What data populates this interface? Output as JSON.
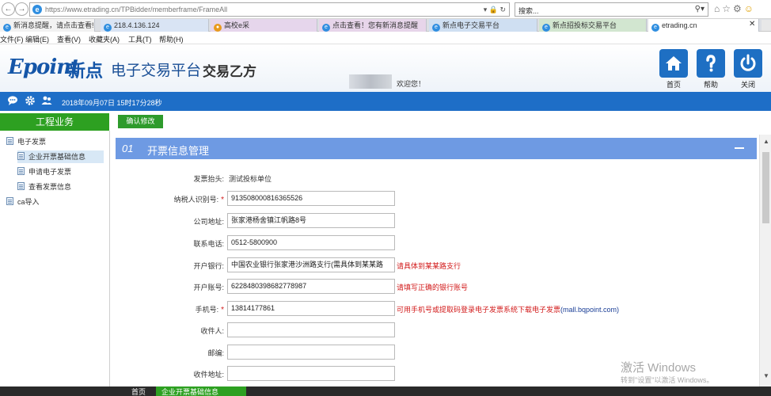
{
  "browser": {
    "url": "https://www.etrading.cn/TPBidder/memberframe/FrameAll",
    "search_placeholder": "搜索...",
    "tabs": [
      "新消息提醒，请点击查看!",
      "218.4.136.124",
      "高校e采",
      "点击查看！您有新消息提醒",
      "新点电子交易平台",
      "新点招投标交易平台",
      "etrading.cn"
    ],
    "menu": [
      "文件(F)",
      "编辑(E)",
      "查看(V)",
      "收藏夹(A)",
      "工具(T)",
      "帮助(H)"
    ]
  },
  "header": {
    "logo_en": "Epoint",
    "logo_cn": "新点",
    "platform": "电子交易平台",
    "role": "交易乙方",
    "welcome": "欢迎您！",
    "buttons": [
      {
        "label": "首页",
        "icon": "home-icon"
      },
      {
        "label": "帮助",
        "icon": "help-icon"
      },
      {
        "label": "关闭",
        "icon": "power-icon"
      }
    ],
    "datetime": "2018年09月07日 15时17分28秒"
  },
  "sidebar": {
    "title": "工程业务",
    "items": [
      {
        "label": "电子发票",
        "level": 0
      },
      {
        "label": "企业开票基础信息",
        "level": 1,
        "selected": true
      },
      {
        "label": "申请电子发票",
        "level": 1
      },
      {
        "label": "查看发票信息",
        "level": 1
      },
      {
        "label": "ca导入",
        "level": 0
      }
    ]
  },
  "toolbar": {
    "confirm_label": "确认修改"
  },
  "panel": {
    "number": "01",
    "title": "开票信息管理"
  },
  "form": {
    "invoice_title_label": "发票抬头:",
    "invoice_title_value": "测试投标单位",
    "taxpayer_id_label": "纳税人识别号:",
    "taxpayer_id_value": "913508000816365526",
    "company_address_label": "公司地址:",
    "company_address_value": "张家港杨舍镇江帆路8号",
    "phone_label": "联系电话:",
    "phone_value": "0512-5800900",
    "bank_label": "开户银行:",
    "bank_value": "中国农业银行张家港沙洲路支行(需具体到某某路",
    "bank_hint": "请具体到某某路支行",
    "account_label": "开户账号:",
    "account_value": "6228480398682778987",
    "account_hint": "请填写正确的银行账号",
    "mobile_label": "手机号:",
    "mobile_value": "13814177861",
    "mobile_hint": "可用手机号或提取码登录电子发票系统下载电子发票",
    "mobile_hint_link": "(mall.bqpoint.com)",
    "receiver_label": "收件人:",
    "receiver_value": "",
    "postcode_label": "邮编:",
    "postcode_value": "",
    "mail_address_label": "收件地址:",
    "mail_address_value": ""
  },
  "watermark": {
    "line1": "激活 Windows",
    "line2": "转到\"设置\"以激活 Windows。"
  },
  "bottom_tabs": [
    {
      "label": "首页",
      "active": false
    },
    {
      "label": "企业开票基础信息",
      "active": true
    }
  ],
  "colors": {
    "brand_blue": "#1e6ec7",
    "sidebar_green": "#2da021",
    "panel_blue": "#6e9ae3",
    "error_red": "#d21a1a"
  }
}
